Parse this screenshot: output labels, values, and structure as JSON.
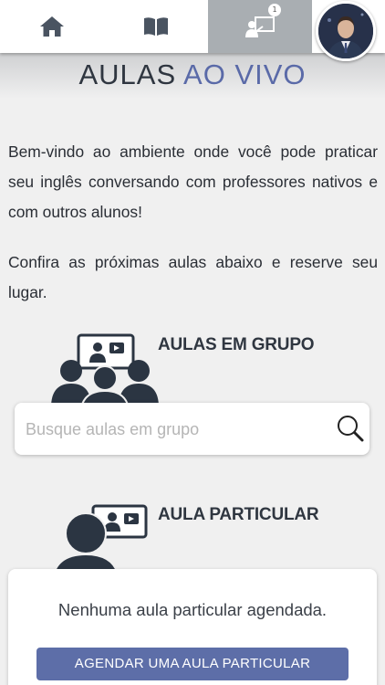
{
  "nav": {
    "items": [
      {
        "name": "home",
        "icon": "home-icon"
      },
      {
        "name": "lessons",
        "icon": "open-book-icon"
      },
      {
        "name": "live-classes",
        "icon": "live-class-icon",
        "active": true,
        "badge": "1"
      }
    ],
    "avatar": "profile-avatar"
  },
  "header": {
    "title_part1": "AULAS ",
    "title_part2": "AO VIVO",
    "title_color1": "#2f3640",
    "title_color2": "#5a6aa8"
  },
  "intro": {
    "paragraph1": "Bem-vindo ao ambiente onde você pode praticar seu inglês conversando com professores nativos e com outros alunos!",
    "paragraph2": "Confira as próximas aulas abaixo e reserve seu lugar."
  },
  "group_section": {
    "title": "AULAS EM GRUPO",
    "icon": "group-class-icon",
    "search_placeholder": "Busque aulas em grupo",
    "search_value": ""
  },
  "private_section": {
    "title": "AULA PARTICULAR",
    "icon": "private-class-icon",
    "empty_message": "Nenhuma aula particular agendada.",
    "button_label": "AGENDAR UMA AULA PARTICULAR"
  },
  "colors": {
    "accent": "#5d6ea8",
    "icon_dark": "#2b3542",
    "active_tab": "#a9aeb2"
  }
}
